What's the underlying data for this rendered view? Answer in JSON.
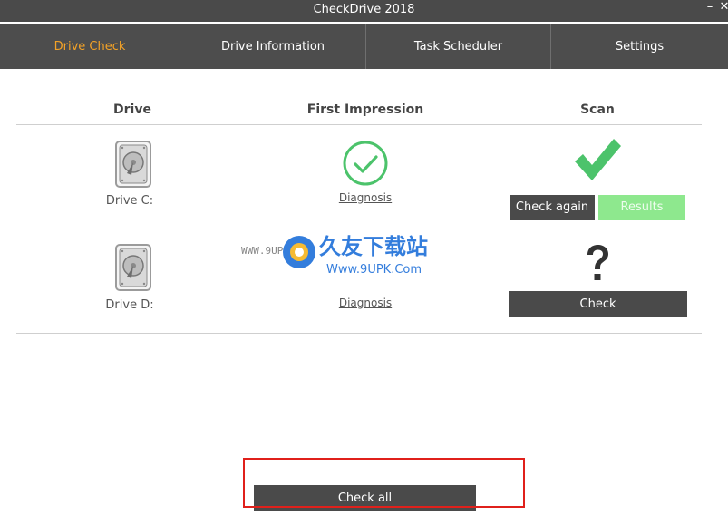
{
  "window": {
    "title": "CheckDrive 2018",
    "minimize_glyph": "–",
    "close_glyph": "✕"
  },
  "tabs": [
    {
      "label": "Drive Check",
      "active": true
    },
    {
      "label": "Drive Information",
      "active": false
    },
    {
      "label": "Task Scheduler",
      "active": false
    },
    {
      "label": "Settings",
      "active": false
    }
  ],
  "table": {
    "headers": {
      "drive": "Drive",
      "first_impression": "First Impression",
      "scan": "Scan"
    },
    "rows": [
      {
        "drive_label": "Drive C:",
        "drive_icon": "hard-drive-icon",
        "impression_icon": "check-circle-icon",
        "impression_link": "Diagnosis",
        "scan_icon": "big-checkmark-icon",
        "check_again_label": "Check again",
        "results_label": "Results"
      },
      {
        "drive_label": "Drive D:",
        "drive_icon": "hard-drive-icon",
        "impression_link": "Diagnosis",
        "scan_icon": "question-mark-icon",
        "check_label": "Check"
      }
    ]
  },
  "footer": {
    "check_all_label": "Check all"
  },
  "watermark": {
    "left_text": "WWW.9UPK.COM",
    "brand_text": "久友下载站",
    "url_text": "Www.9UPK.Com"
  },
  "colors": {
    "accent_tab": "#f3a227",
    "success_green": "#4cc36b",
    "results_green": "#8ee88e",
    "dark_button": "#4a4a4a",
    "highlight_red": "#e0201b"
  }
}
